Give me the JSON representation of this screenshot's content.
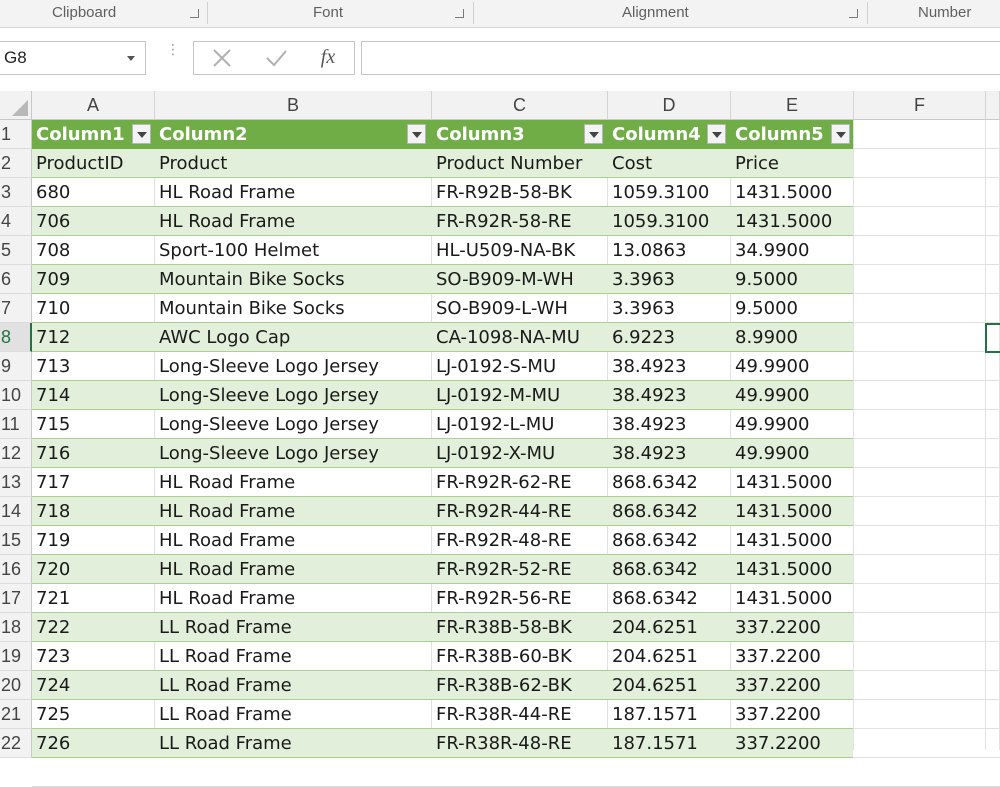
{
  "ribbon": {
    "groups": [
      {
        "label": "Clipboard"
      },
      {
        "label": "Font"
      },
      {
        "label": "Alignment"
      },
      {
        "label": "Number"
      }
    ]
  },
  "formula_bar": {
    "name_box": "G8",
    "fx_label": "fx",
    "formula": ""
  },
  "column_headers": [
    "A",
    "B",
    "C",
    "D",
    "E",
    "F"
  ],
  "row_numbers": [
    "1",
    "2",
    "3",
    "4",
    "5",
    "6",
    "7",
    "8",
    "9",
    "10",
    "11",
    "12",
    "13",
    "14",
    "15",
    "16",
    "17",
    "18",
    "19",
    "20",
    "21",
    "22"
  ],
  "selected_cell": "G8",
  "table": {
    "style_colors": {
      "header": "#70ad47",
      "band": "#e2efda",
      "band_border": "#a9d08e"
    },
    "headers": [
      "Column1",
      "Column2",
      "Column3",
      "Column4",
      "Column5"
    ],
    "rows": [
      [
        "ProductID",
        "Product",
        "Product Number",
        "Cost",
        "Price"
      ],
      [
        "680",
        "HL Road Frame",
        "FR-R92B-58-BK",
        "1059.3100",
        "1431.5000"
      ],
      [
        "706",
        "HL Road Frame",
        "FR-R92R-58-RE",
        "1059.3100",
        "1431.5000"
      ],
      [
        "708",
        "Sport-100 Helmet",
        "HL-U509-NA-BK",
        "13.0863",
        "34.9900"
      ],
      [
        "709",
        "Mountain Bike Socks",
        "SO-B909-M-WH",
        "3.3963",
        "9.5000"
      ],
      [
        "710",
        "Mountain Bike Socks",
        "SO-B909-L-WH",
        "3.3963",
        "9.5000"
      ],
      [
        "712",
        "AWC Logo Cap",
        "CA-1098-NA-MU",
        "6.9223",
        "8.9900"
      ],
      [
        "713",
        "Long-Sleeve Logo Jersey",
        "LJ-0192-S-MU",
        "38.4923",
        "49.9900"
      ],
      [
        "714",
        "Long-Sleeve Logo Jersey",
        "LJ-0192-M-MU",
        "38.4923",
        "49.9900"
      ],
      [
        "715",
        "Long-Sleeve Logo Jersey",
        "LJ-0192-L-MU",
        "38.4923",
        "49.9900"
      ],
      [
        "716",
        "Long-Sleeve Logo Jersey",
        "LJ-0192-X-MU",
        "38.4923",
        "49.9900"
      ],
      [
        "717",
        "HL Road Frame",
        "FR-R92R-62-RE",
        "868.6342",
        "1431.5000"
      ],
      [
        "718",
        "HL Road Frame",
        "FR-R92R-44-RE",
        "868.6342",
        "1431.5000"
      ],
      [
        "719",
        "HL Road Frame",
        "FR-R92R-48-RE",
        "868.6342",
        "1431.5000"
      ],
      [
        "720",
        "HL Road Frame",
        "FR-R92R-52-RE",
        "868.6342",
        "1431.5000"
      ],
      [
        "721",
        "HL Road Frame",
        "FR-R92R-56-RE",
        "868.6342",
        "1431.5000"
      ],
      [
        "722",
        "LL Road Frame",
        "FR-R38B-58-BK",
        "204.6251",
        "337.2200"
      ],
      [
        "723",
        "LL Road Frame",
        "FR-R38B-60-BK",
        "204.6251",
        "337.2200"
      ],
      [
        "724",
        "LL Road Frame",
        "FR-R38B-62-BK",
        "204.6251",
        "337.2200"
      ],
      [
        "725",
        "LL Road Frame",
        "FR-R38R-44-RE",
        "187.1571",
        "337.2200"
      ],
      [
        "726",
        "LL Road Frame",
        "FR-R38R-48-RE",
        "187.1571",
        "337.2200"
      ]
    ]
  }
}
